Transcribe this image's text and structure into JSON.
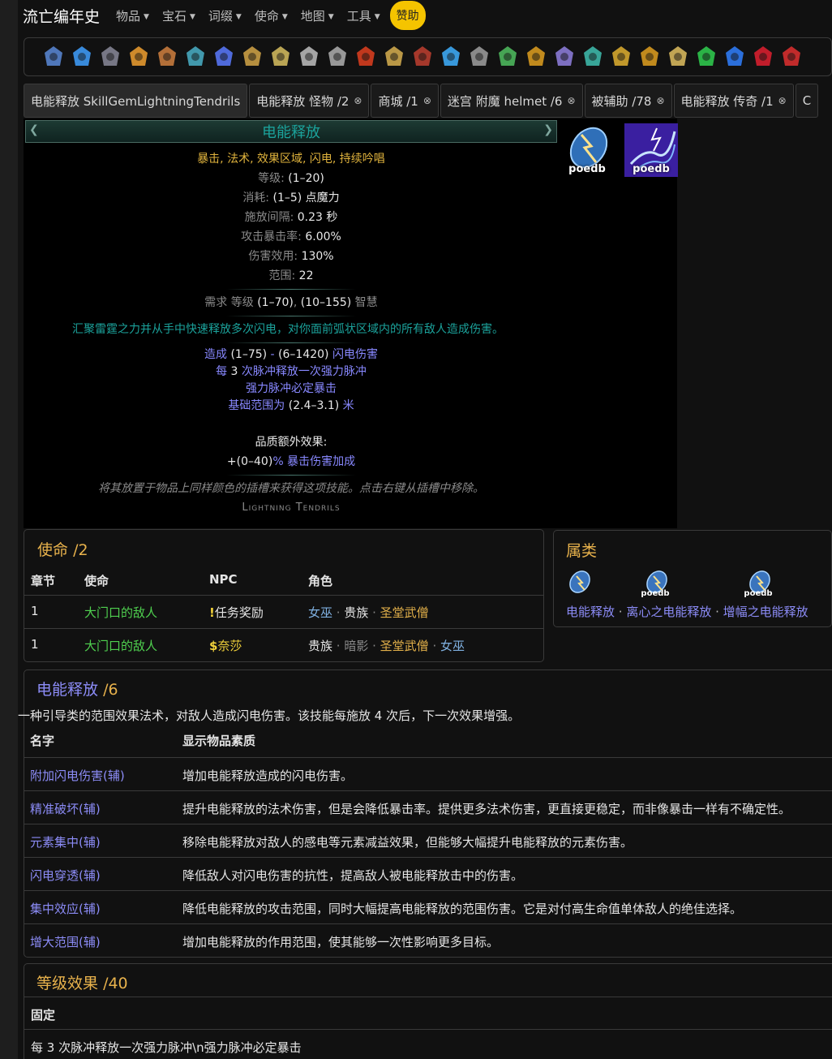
{
  "nav": {
    "brand": "流亡编年史",
    "items": [
      "物品",
      "宝石",
      "词缀",
      "使命",
      "地图",
      "工具"
    ],
    "sponsor": "赞助"
  },
  "icons": [
    "gem-icon",
    "crystal-icon",
    "coil-icon",
    "flame-altar-icon",
    "pillar-icon",
    "bars-icon",
    "spirit-icon",
    "disc-icon",
    "insect-icon",
    "spider-icon",
    "totem-icon",
    "fire-face-icon",
    "mask-icon",
    "rune-circle-icon",
    "storm-icon",
    "cloud-icon",
    "green-card-icon",
    "gold-idol-icon",
    "twin-crystal-icon",
    "horned-helm-icon",
    "gold-flame-icon",
    "gold-eye-icon",
    "bird-skull-icon",
    "green-orb-icon",
    "blue-spiked-orb-icon",
    "red-hand-icon",
    "red-blade-icon"
  ],
  "tabs": [
    {
      "label": "电能释放 SkillGemLightningTendrils",
      "closable": false,
      "active": true
    },
    {
      "label": "电能释放 怪物 /2",
      "closable": true
    },
    {
      "label": "商城 /1",
      "closable": true
    },
    {
      "label": "迷宫 附魔 helmet /6",
      "closable": true
    },
    {
      "label": "被辅助 /78",
      "closable": true
    },
    {
      "label": "电能释放 传奇 /1",
      "closable": true
    },
    {
      "label": "C",
      "closable": false
    }
  ],
  "gem": {
    "name": "电能释放",
    "tags": "暴击, 法术, 效果区域, 闪电, 持续吟唱",
    "stats": [
      {
        "label": "等级: ",
        "value": "(1–20)"
      },
      {
        "label": "消耗: ",
        "value": "(1–5) 点魔力"
      },
      {
        "label": "施放间隔: ",
        "value": "0.23 秒"
      },
      {
        "label": "攻击暴击率: ",
        "value": "6.00%"
      },
      {
        "label": "伤害效用: ",
        "value": "130%"
      },
      {
        "label": "范围: ",
        "value": "22"
      }
    ],
    "requirement": {
      "prefix": "需求 等级 ",
      "level": "(1–70)",
      "sep": ", ",
      "int": "(10–155)",
      "suffix": " 智慧"
    },
    "description": "汇聚雷霆之力并从手中快速释放多次闪电，对你面前弧状区域内的所有敌人造成伤害。",
    "mods": {
      "m1_a": "造成 ",
      "m1_b": "(1–75)",
      "m1_c": " - ",
      "m1_d": "(6–1420)",
      "m1_e": " 闪电伤害",
      "m2_a": "每 ",
      "m2_b": "3",
      "m2_c": " 次脉冲释放一次强力脉冲",
      "m3": "强力脉冲必定暴击",
      "m4_a": "基础范围为 ",
      "m4_b": "(2.4–3.1)",
      "m4_c": " 米"
    },
    "quality_header": "品质额外效果:",
    "quality_a": "+(0–40)",
    "quality_b": "% 暴击伤害加成",
    "flavour": "将其放置于物品上同样颜色的插槽来获得这项技能。点击右键从插槽中移除。",
    "internal_name": "Lightning Tendrils",
    "image_label": "poedb"
  },
  "quests": {
    "title": "使命",
    "count": "/2",
    "headers": [
      "章节",
      "使命",
      "NPC",
      "角色"
    ],
    "rows": [
      {
        "chapter": "1",
        "quest": "大门口的敌人",
        "npc_mark": "!",
        "npc": "任务奖励",
        "classes": [
          {
            "name": "女巫",
            "c": "lblue"
          },
          {
            "name": "贵族",
            "c": "white"
          },
          {
            "name": "圣堂武僧",
            "c": "sgold"
          }
        ]
      },
      {
        "chapter": "1",
        "quest": "大门口的敌人",
        "npc_mark": "$",
        "npc": "奈莎",
        "classes": [
          {
            "name": "贵族",
            "c": "white"
          },
          {
            "name": "暗影",
            "c": "grey"
          },
          {
            "name": "圣堂武僧",
            "c": "sgold"
          },
          {
            "name": "女巫",
            "c": "lblue"
          }
        ]
      }
    ]
  },
  "family": {
    "title": "属类",
    "items": [
      {
        "name": "电能释放",
        "badge": ""
      },
      {
        "name": "离心之电能释放",
        "badge": "poedb"
      },
      {
        "name": "增幅之电能释放",
        "badge": "poedb"
      }
    ],
    "sep": " · "
  },
  "support": {
    "title": "电能释放",
    "count": "/6",
    "intro": "一种引导类的范围效果法术，对敌人造成闪电伤害。该技能每施放 4 次后，下一次效果增强。",
    "headers": [
      "名字",
      "显示物品素质"
    ],
    "rows": [
      {
        "name": "附加闪电伤害(辅)",
        "desc": "增加电能释放造成的闪电伤害。"
      },
      {
        "name": "精准破坏(辅)",
        "desc": "提升电能释放的法术伤害，但是会降低暴击率。提供更多法术伤害，更直接更稳定，而非像暴击一样有不确定性。"
      },
      {
        "name": "元素集中(辅)",
        "desc": "移除电能释放对敌人的感电等元素减益效果，但能够大幅提升电能释放的元素伤害。"
      },
      {
        "name": "闪电穿透(辅)",
        "desc": "降低敌人对闪电伤害的抗性，提高敌人被电能释放击中的伤害。"
      },
      {
        "name": "集中效应(辅)",
        "desc": "降低电能释放的攻击范围，同时大幅提高电能释放的范围伤害。它是对付高生命值单体敌人的绝佳选择。"
      },
      {
        "name": "增大范围(辅)",
        "desc": "增加电能释放的作用范围，使其能够一次性影响更多目标。"
      }
    ]
  },
  "level": {
    "title": "等级效果",
    "count": "/40",
    "header": "固定",
    "row": "每 3 次脉冲释放一次强力脉冲\\n强力脉冲必定暴击"
  },
  "colors": {
    "accent_gold": "#e8b24c",
    "tag_gold": "#e0b33d",
    "gem_teal": "#1ba29b",
    "magic_blue": "#8888ff",
    "quest_green": "#4fd04f",
    "sponsor_yellow": "#f5c400"
  }
}
